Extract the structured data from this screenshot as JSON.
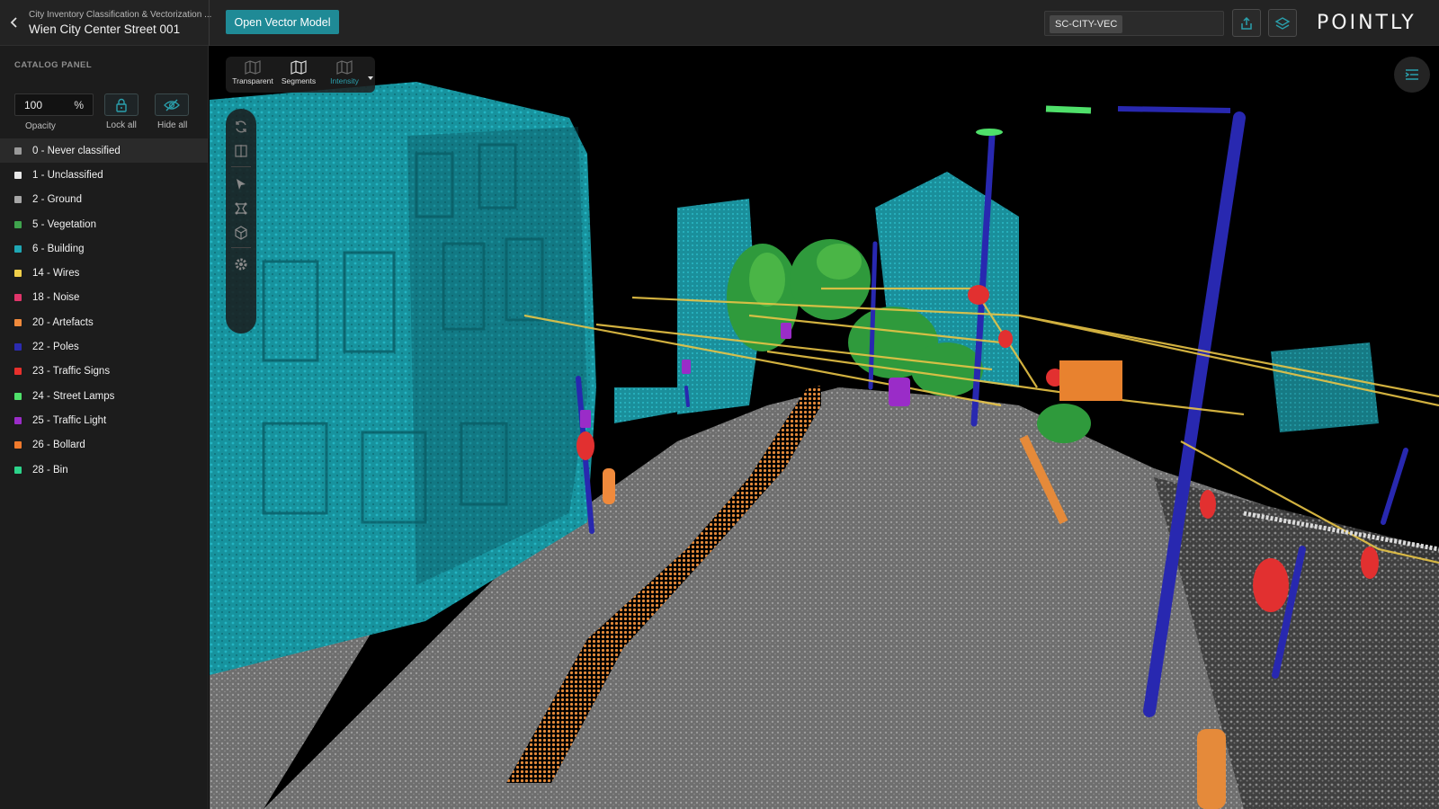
{
  "header": {
    "project_subtitle": "City Inventory Classification & Vectorization ...",
    "project_title": "Wien City Center Street 001",
    "open_vector_label": "Open Vector Model",
    "search_chip": "SC-CITY-VEC",
    "logo": "POINTLY"
  },
  "sidebar": {
    "title": "CATALOG PANEL",
    "opacity_value": "100",
    "opacity_unit": "%",
    "opacity_label": "Opacity",
    "lock_label": "Lock all",
    "hide_label": "Hide all",
    "classes": [
      {
        "label": "0 - Never classified",
        "color": "#9a9a9a"
      },
      {
        "label": "1 - Unclassified",
        "color": "#e8e8e8"
      },
      {
        "label": "2 - Ground",
        "color": "#a6a6a6"
      },
      {
        "label": "5 - Vegetation",
        "color": "#3fa34d"
      },
      {
        "label": "6 - Building",
        "color": "#1fa7b4"
      },
      {
        "label": "14 - Wires",
        "color": "#f0cf4a"
      },
      {
        "label": "18 - Noise",
        "color": "#e0356a"
      },
      {
        "label": "20 - Artefacts",
        "color": "#f08a3c"
      },
      {
        "label": "22 - Poles",
        "color": "#2b2bb0"
      },
      {
        "label": "23 - Traffic Signs",
        "color": "#e8302c"
      },
      {
        "label": "24 - Street Lamps",
        "color": "#4fe06a"
      },
      {
        "label": "25 - Traffic Light",
        "color": "#9a2cc8"
      },
      {
        "label": "26 - Bollard",
        "color": "#f07a2c"
      },
      {
        "label": "28 - Bin",
        "color": "#2cd38a"
      }
    ]
  },
  "viewer": {
    "render_modes": [
      "Transparent",
      "Segments",
      "Intensity"
    ],
    "active_mode": "Intensity"
  }
}
